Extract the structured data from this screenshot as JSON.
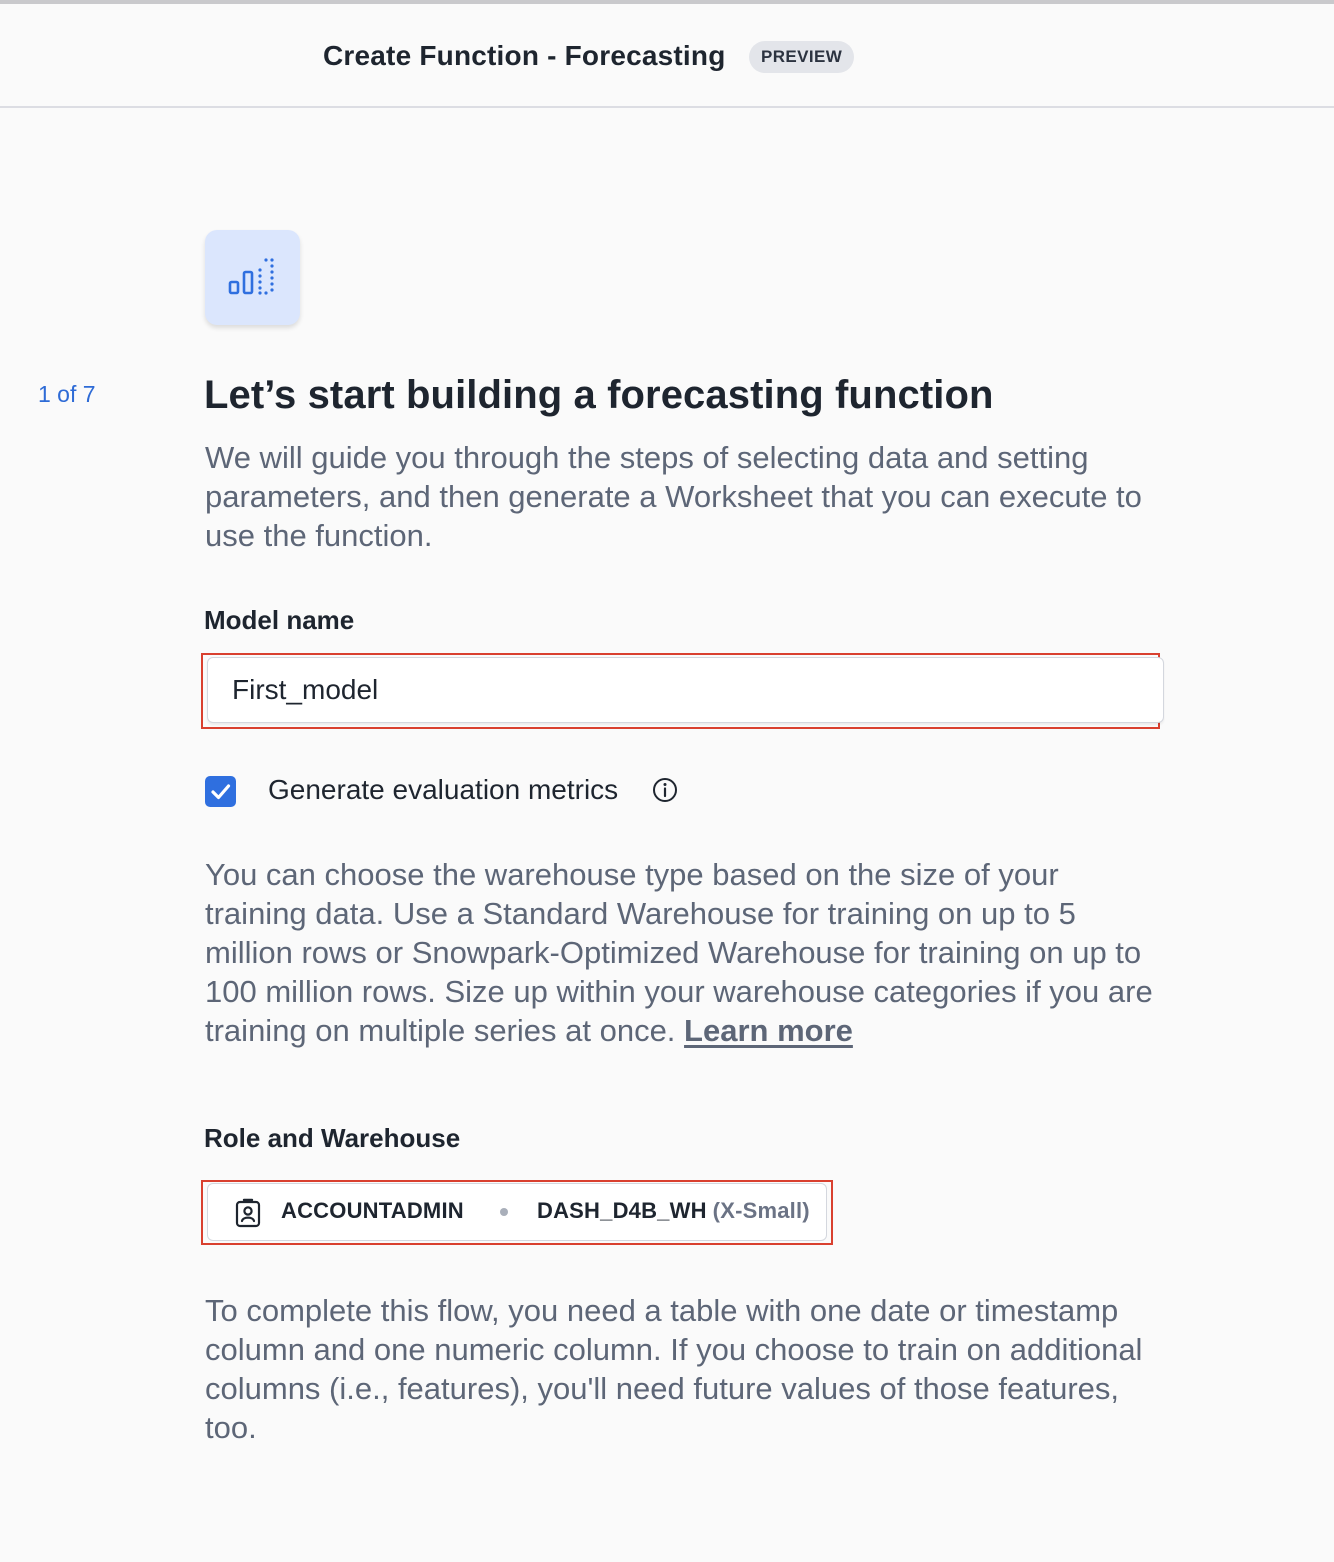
{
  "header": {
    "title": "Create Function - Forecasting",
    "badge": "PREVIEW"
  },
  "step": {
    "counter": "1 of 7",
    "icon": "forecast-chart-icon"
  },
  "main": {
    "title": "Let’s start building a forecasting function",
    "intro": "We will guide you through the steps of selecting data and setting parameters, and then generate a Worksheet that you can execute to use the function."
  },
  "model_name": {
    "label": "Model name",
    "value": "First_model"
  },
  "evaluation": {
    "label": "Generate evaluation metrics",
    "checked": true,
    "info_icon": "info-icon"
  },
  "warehouse_description": {
    "text": "You can choose the warehouse type based on the size of your training data. Use a Standard Warehouse for training on up to 5 million rows or Snowpark-Optimized Warehouse for training on up to 100 million rows. Size up within your warehouse categories if you are training on multiple series at once. ",
    "link": "Learn more"
  },
  "role_warehouse": {
    "label": "Role and Warehouse",
    "role": "ACCOUNTADMIN",
    "warehouse": "DASH_D4B_WH",
    "warehouse_size": "(X-Small)",
    "role_icon": "user-badge-icon"
  },
  "flow_description": "To complete this flow, you need a table with one date or timestamp column and one numeric column. If you choose to train on additional columns (i.e., features), you'll need future values of those features, too.",
  "colors": {
    "accent": "#2f6fdf",
    "highlight_border": "#d9402f",
    "icon_tile": "#dbe6fd"
  }
}
